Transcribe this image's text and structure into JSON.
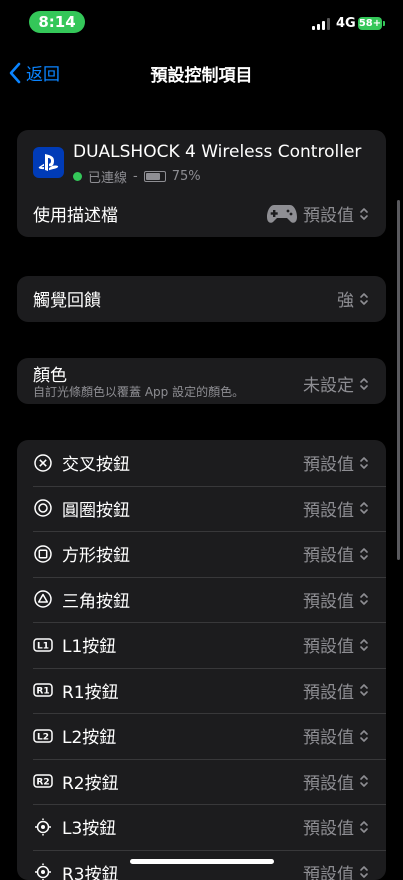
{
  "status_bar": {
    "time": "8:14",
    "network": "4G",
    "battery": "58+"
  },
  "nav": {
    "back_label": "返回",
    "title": "預設控制項目"
  },
  "controller": {
    "name": "DUALSHOCK 4 Wireless Controller",
    "connection": "已連線",
    "separator": "-",
    "battery": "75%",
    "profile_label": "使用描述檔",
    "profile_value": "預設值"
  },
  "haptics": {
    "label": "觸覺回饋",
    "value": "強"
  },
  "color": {
    "label": "顏色",
    "description": "自訂光條顏色以覆蓋 App 設定的顏色。",
    "value": "未設定"
  },
  "buttons": [
    {
      "icon": "cross-icon",
      "label": "交叉按鈕",
      "value": "預設值"
    },
    {
      "icon": "circle-icon",
      "label": "圓圈按鈕",
      "value": "預設值"
    },
    {
      "icon": "square-icon",
      "label": "方形按鈕",
      "value": "預設值"
    },
    {
      "icon": "triangle-icon",
      "label": "三角按鈕",
      "value": "預設值"
    },
    {
      "icon": "l1-icon",
      "glyph": "L1",
      "label": "L1按鈕",
      "value": "預設值"
    },
    {
      "icon": "r1-icon",
      "glyph": "R1",
      "label": "R1按鈕",
      "value": "預設值"
    },
    {
      "icon": "l2-icon",
      "glyph": "L2",
      "label": "L2按鈕",
      "value": "預設值"
    },
    {
      "icon": "r2-icon",
      "glyph": "R2",
      "label": "R2按鈕",
      "value": "預設值"
    },
    {
      "icon": "l3-icon",
      "label": "L3按鈕",
      "value": "預設值"
    },
    {
      "icon": "r3-icon",
      "label": "R3按鈕",
      "value": "預設值"
    }
  ],
  "colors": {
    "accent": "#0a84ff",
    "connected": "#34c759",
    "card": "#1c1c1e",
    "secondary_text": "#8e8e93"
  }
}
